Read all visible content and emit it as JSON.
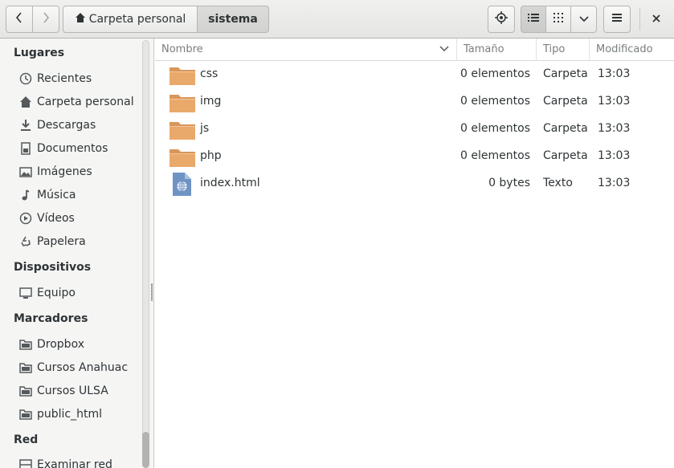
{
  "header": {
    "breadcrumbs": [
      "Carpeta personal",
      "sistema"
    ],
    "icons": {
      "back": "chevron-left-icon",
      "forward": "chevron-right-icon",
      "home": "home-icon",
      "location": "location-target-icon",
      "list_view": "list-view-icon",
      "grid_view": "grid-view-icon",
      "view_options": "chevron-down-icon",
      "menu": "hamburger-menu-icon",
      "close": "close-icon"
    }
  },
  "sidebar": {
    "sections": [
      {
        "title": "Lugares",
        "items": [
          {
            "label": "Recientes",
            "icon": "clock-icon"
          },
          {
            "label": "Carpeta personal",
            "icon": "home-icon"
          },
          {
            "label": "Descargas",
            "icon": "download-icon"
          },
          {
            "label": "Documentos",
            "icon": "document-icon"
          },
          {
            "label": "Imágenes",
            "icon": "image-icon"
          },
          {
            "label": "Música",
            "icon": "music-icon"
          },
          {
            "label": "Vídeos",
            "icon": "video-icon"
          },
          {
            "label": "Papelera",
            "icon": "trash-icon"
          }
        ]
      },
      {
        "title": "Dispositivos",
        "items": [
          {
            "label": "Equipo",
            "icon": "computer-icon"
          }
        ]
      },
      {
        "title": "Marcadores",
        "items": [
          {
            "label": "Dropbox",
            "icon": "folder-icon"
          },
          {
            "label": "Cursos Anahuac",
            "icon": "folder-icon"
          },
          {
            "label": "Cursos ULSA",
            "icon": "folder-icon"
          },
          {
            "label": "public_html",
            "icon": "folder-icon"
          }
        ]
      },
      {
        "title": "Red",
        "items": [
          {
            "label": "Examinar red",
            "icon": "network-icon"
          }
        ]
      }
    ]
  },
  "list": {
    "columns": [
      "Nombre",
      "Tamaño",
      "Tipo",
      "Modificado"
    ],
    "rows": [
      {
        "name": "css",
        "size": "0 elementos",
        "type": "Carpeta",
        "modified": "13:03",
        "icon": "folder-icon"
      },
      {
        "name": "img",
        "size": "0 elementos",
        "type": "Carpeta",
        "modified": "13:03",
        "icon": "folder-icon"
      },
      {
        "name": "js",
        "size": "0 elementos",
        "type": "Carpeta",
        "modified": "13:03",
        "icon": "folder-icon"
      },
      {
        "name": "php",
        "size": "0 elementos",
        "type": "Carpeta",
        "modified": "13:03",
        "icon": "folder-icon"
      },
      {
        "name": "index.html",
        "size": "0 bytes",
        "type": "Texto",
        "modified": "13:03",
        "icon": "html-file-icon"
      }
    ]
  },
  "colors": {
    "folder": "#e9a96b",
    "html_file": "#6f94c4",
    "selected_button": "#d2d2d0"
  }
}
